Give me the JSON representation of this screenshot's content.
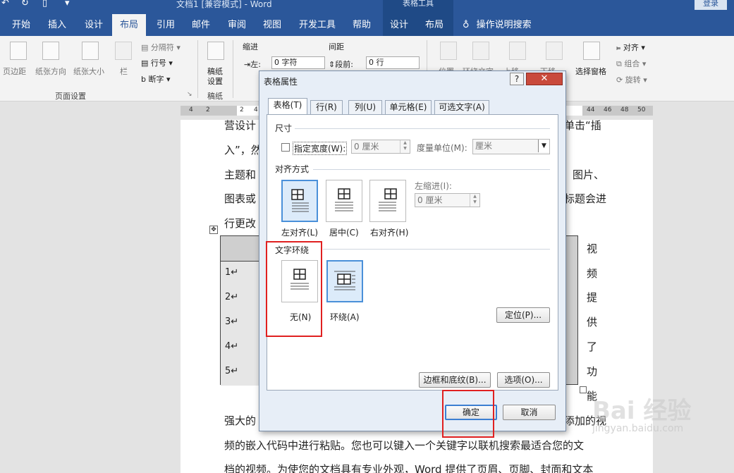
{
  "titlebar": {
    "doc_title": "文档1 [兼容模式] - Word",
    "context_title": "表格工具",
    "login_label": "登录"
  },
  "tabs": [
    "开始",
    "插入",
    "设计",
    "布局",
    "引用",
    "邮件",
    "审阅",
    "视图",
    "开发工具",
    "帮助",
    "设计",
    "布局"
  ],
  "tell_me": "操作说明搜索",
  "ribbon": {
    "margins": "页边距",
    "orientation": "纸张方向",
    "size": "纸张大小",
    "columns": "栏",
    "breaks": "分隔符",
    "line_numbers": "行号",
    "hyphenation": "断字",
    "page_setup_group": "页面设置",
    "manuscript": "稿纸",
    "manuscript_setup": "设置",
    "manuscript_group": "稿纸",
    "indent": "缩进",
    "spacing": "间距",
    "indent_left_label": "左:",
    "indent_left_value": "0 字符",
    "spacing_before_label": "段前:",
    "spacing_before_value": "0 行",
    "position": "位置",
    "wrap_text": "环绕文字",
    "bring_forward": "上移",
    "send_backward": "下移",
    "selection_pane": "选择窗格",
    "align": "对齐",
    "group": "组合",
    "rotate": "旋转"
  },
  "ruler": [
    "4",
    "2",
    "2",
    "4",
    "44",
    "46",
    "48",
    "50"
  ],
  "document": {
    "line1": "营设计",
    "line2": "入”，然",
    "line3": "主题和",
    "line4": "图表或",
    "line5": "行更改",
    "right1": "单击“插",
    "right3": "图片、",
    "right4": "标题会进",
    "vertical_chars": [
      "视",
      "频",
      "提",
      "供",
      "了",
      "功",
      "能"
    ],
    "table_rows": [
      "1↵",
      "2↵",
      "3↵",
      "4↵",
      "5↵"
    ],
    "bottom1_left": "强大的",
    "bottom1_right": "添加的视",
    "bottom2": "频的嵌入代码中进行粘贴。您也可以键入一个关键字以联机搜索最适合您的文",
    "bottom3": "档的视频。为使您的文档具有专业外观，Word 提供了页眉、页脚、封面和文本"
  },
  "dialog": {
    "title": "表格属性",
    "help": "?",
    "close": "✕",
    "tabs": [
      "表格(T)",
      "行(R)",
      "列(U)",
      "单元格(E)",
      "可选文字(A)"
    ],
    "size_section": "尺寸",
    "preferred_width_label": "指定宽度(W):",
    "preferred_width_value": "0 厘米",
    "measure_in_label": "度量单位(M):",
    "measure_in_value": "厘米",
    "alignment_section": "对齐方式",
    "align_left": "左对齐(L)",
    "align_center": "居中(C)",
    "align_right": "右对齐(H)",
    "indent_left_label": "左缩进(I):",
    "indent_left_value": "0 厘米",
    "wrapping_section": "文字环绕",
    "wrap_none": "无(N)",
    "wrap_around": "环绕(A)",
    "positioning_button": "定位(P)...",
    "borders_button": "边框和底纹(B)...",
    "options_button": "选项(O)...",
    "ok_button": "确定",
    "cancel_button": "取消"
  },
  "watermark": {
    "text": "Bai 经验",
    "url": "jingyan.baidu.com"
  }
}
